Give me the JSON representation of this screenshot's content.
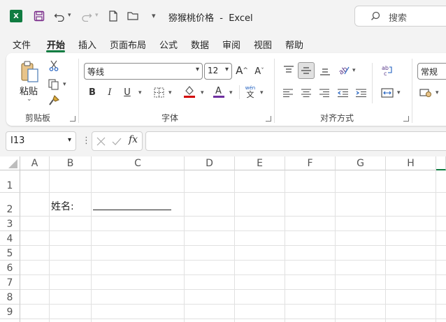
{
  "title_bar": {
    "app_icon": "X",
    "title": "猕猴桃价格  -  Excel",
    "search_placeholder": "搜索"
  },
  "tabs": [
    {
      "label": "文件"
    },
    {
      "label": "开始",
      "active": true
    },
    {
      "label": "插入"
    },
    {
      "label": "页面布局"
    },
    {
      "label": "公式"
    },
    {
      "label": "数据"
    },
    {
      "label": "审阅"
    },
    {
      "label": "视图"
    },
    {
      "label": "帮助"
    }
  ],
  "ribbon": {
    "clipboard": {
      "paste_label": "粘贴",
      "group_label": "剪贴板"
    },
    "font": {
      "font_name": "等线",
      "font_size": "12",
      "group_label": "字体",
      "phonetic_glyph": "wén"
    },
    "alignment": {
      "group_label": "对齐方式"
    },
    "number": {
      "format": "常规"
    }
  },
  "formula_bar": {
    "name_box": "I13",
    "fx_label": "fx",
    "formula": ""
  },
  "sheet": {
    "columns": [
      "A",
      "B",
      "C",
      "D",
      "E",
      "F",
      "G",
      "H"
    ],
    "rows": [
      "1",
      "2",
      "3",
      "4",
      "5",
      "6",
      "7",
      "8",
      "9"
    ],
    "cells": {
      "B2": "姓名:"
    }
  },
  "colors": {
    "accent": "#107c41",
    "font_color": "#c00000",
    "highlight": "#d10000",
    "text_color_bar": "#7030a0"
  }
}
